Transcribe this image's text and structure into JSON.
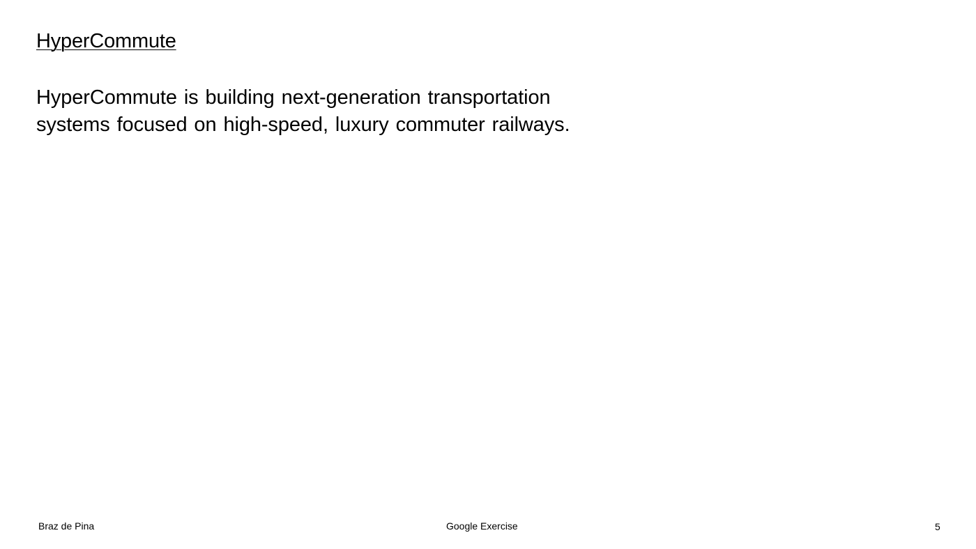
{
  "slide": {
    "title": "HyperCommute",
    "body_lines": [
      "HyperCommute is building next-generation transportation",
      "systems focused on high-speed, luxury commuter railways."
    ]
  },
  "footer": {
    "author": "Braz de Pina",
    "subject": "Google Exercise",
    "page_number": "5"
  },
  "colors": {
    "background": "#ffffff",
    "text": "#000000"
  }
}
